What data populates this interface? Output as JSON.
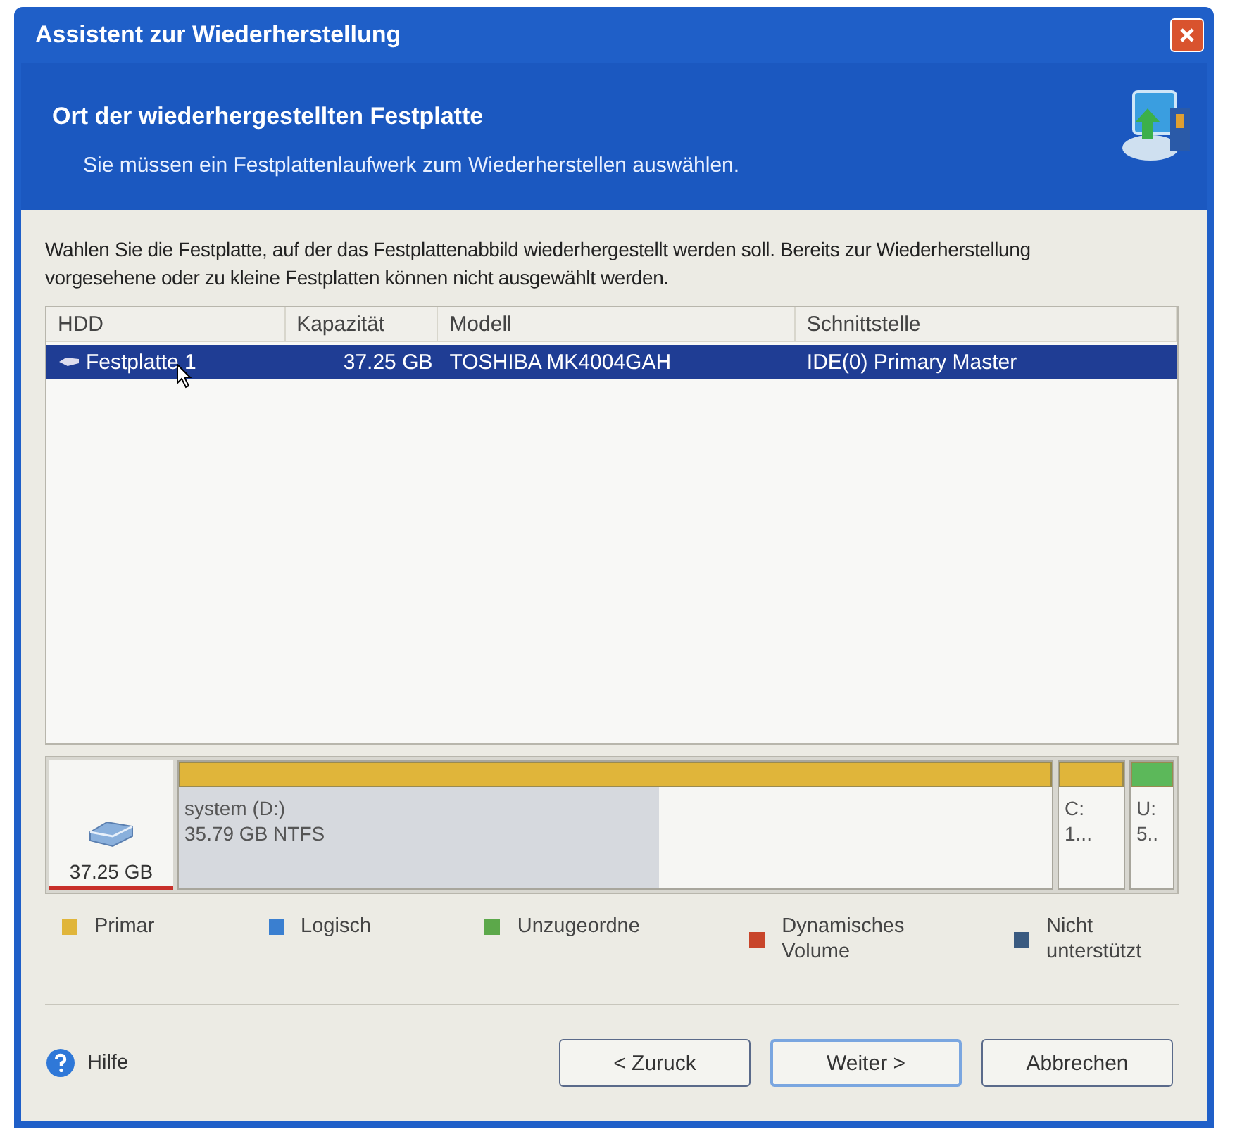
{
  "window": {
    "title": "Assistent zur Wiederherstellung"
  },
  "header": {
    "title": "Ort der wiederhergestellten Festplatte",
    "subtitle": "Sie müssen ein Festplattenlaufwerk zum Wiederherstellen auswählen."
  },
  "description": "Wahlen Sie die Festplatte, auf der das Festplattenabbild wiederhergestellt werden soll. Bereits zur Wiederherstellung vorgesehene oder zu kleine Festplatten können nicht ausgewählt werden.",
  "table": {
    "columns": [
      "HDD",
      "Kapazität",
      "Modell",
      "Schnittstelle"
    ],
    "rows": [
      {
        "cells": [
          "Festplatte 1",
          "37.25 GB",
          "TOSHIBA MK4004GAH",
          "IDE(0) Primary Master"
        ],
        "selected": true
      }
    ]
  },
  "disk_map": {
    "disk_size": "37.25 GB",
    "partitions": [
      {
        "lines": [
          "system (D:)",
          "35.79 GB  NTFS"
        ],
        "color": "#e0b53a",
        "level": 0.55,
        "kind": "wide"
      },
      {
        "lines": [
          "C:",
          "1..."
        ],
        "color": "#e0b53a",
        "kind": "narrow"
      },
      {
        "lines": [
          "U:",
          "5.."
        ],
        "color": "#5cb85a",
        "kind": "narrow"
      }
    ]
  },
  "legend": [
    {
      "label": "Primar",
      "color": "#e0b53a"
    },
    {
      "label": "Logisch",
      "color": "#3a7fd0"
    },
    {
      "label": "Unzugeordne",
      "color": "#5ca84a"
    },
    {
      "label": "Dynamisches Volume",
      "color": "#c8452a"
    },
    {
      "label": "Nicht unterstützt",
      "color": "#3a5a80"
    }
  ],
  "help": "Hilfe",
  "buttons": [
    "< Zuruck",
    "Weiter >",
    "Abbrechen"
  ]
}
